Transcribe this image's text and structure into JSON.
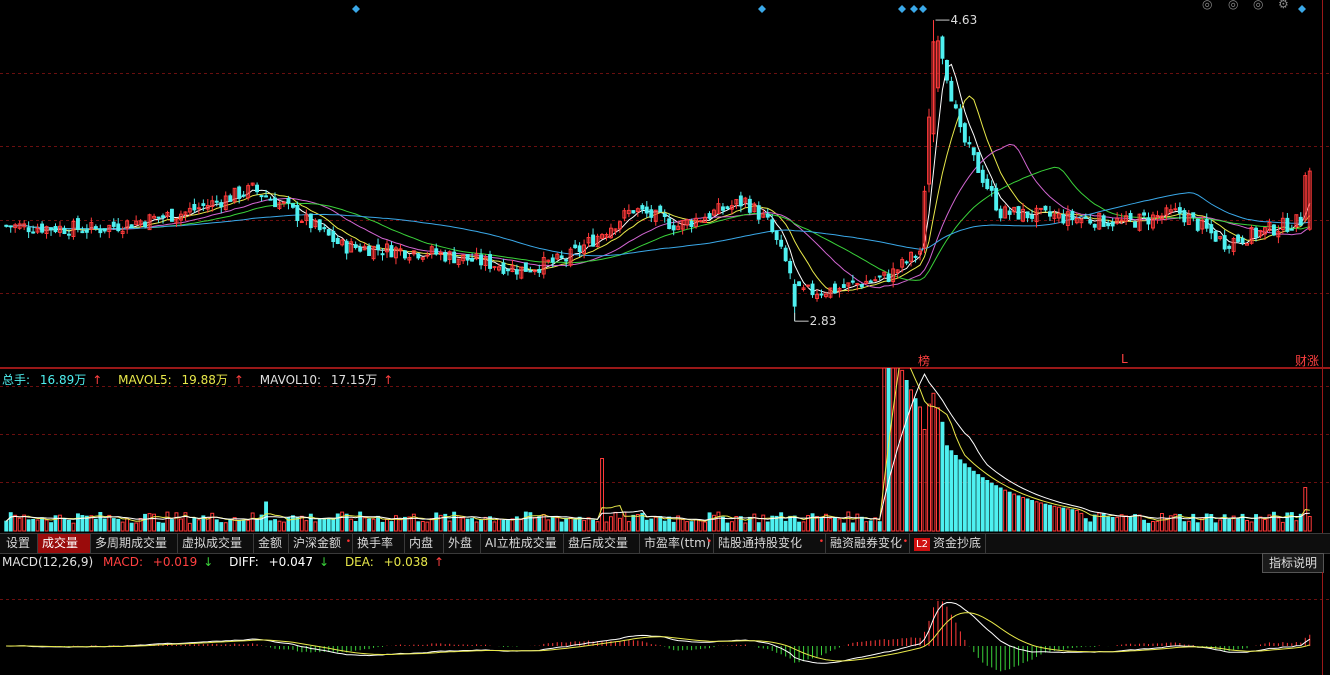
{
  "title": "",
  "price_panel": {
    "high_label": "4.63",
    "low_label": "2.83",
    "markers": [
      "榜",
      "L",
      "财"
    ],
    "marker_tail": "涨"
  },
  "volume_panel": {
    "label_total": "总手: ",
    "total": "16.89万",
    "label_mavol5": "MAVOL5: ",
    "mavol5": "19.88万",
    "label_mavol10": "MAVOL10: ",
    "mavol10": "17.15万",
    "arrow_up": "↑",
    "colors": {
      "total": "#4ff0f0",
      "mavol5": "#e8e84a",
      "mavol10": "#e0e0e0"
    }
  },
  "tabs": [
    {
      "label": "设置",
      "active": false
    },
    {
      "label": "成交量",
      "active": true
    },
    {
      "label": "多周期成交量",
      "active": false
    },
    {
      "label": "虚拟成交量",
      "active": false
    },
    {
      "label": "金额",
      "active": false
    },
    {
      "label": "沪深金额",
      "active": false
    },
    {
      "label": "换手率",
      "active": false
    },
    {
      "label": "内盘",
      "active": false
    },
    {
      "label": "外盘",
      "active": false
    },
    {
      "label": "AI立桩成交量",
      "active": false
    },
    {
      "label": "盘后成交量",
      "active": false
    },
    {
      "label": "市盈率(ttm)",
      "active": false
    },
    {
      "label": "陆股通持股变化",
      "active": false
    },
    {
      "label": "融资融券变化",
      "active": false
    },
    {
      "label": "资金抄底",
      "active": false
    }
  ],
  "l2_badge": "L2",
  "macd_panel": {
    "label": "MACD(12,26,9)",
    "macd_label": "MACD: ",
    "macd": "+0.019",
    "macd_arrow": "↓",
    "diff_label": "DIFF: ",
    "diff": "+0.047",
    "diff_arrow": "↓",
    "dea_label": "DEA: ",
    "dea": "+0.038",
    "dea_arrow": "↑",
    "help_button": "指标说明",
    "colors": {
      "label": "#e0e0e0",
      "macd": "#ff4040",
      "diff": "#ffffff",
      "dea": "#e8e84a"
    }
  },
  "colors": {
    "up": "#ff3a3a",
    "down": "#4ff0f0",
    "grid": "#6a0f0f",
    "border": "#9a1818",
    "ma5": "#ffffff",
    "ma10": "#e8e84a",
    "ma20": "#d266d2",
    "ma30": "#3ad23a",
    "ma60": "#3aa8e8",
    "marker_diamond": "#3aa8e8"
  },
  "chart_data": {
    "type": "candlestick",
    "title": "",
    "y_range": [
      2.55,
      4.75
    ],
    "price_max": 4.63,
    "price_min": 2.83,
    "segments": [
      {
        "from": 0,
        "to": 20,
        "start": 3.4,
        "end": 3.38
      },
      {
        "from": 20,
        "to": 40,
        "start": 3.38,
        "end": 3.48
      },
      {
        "from": 40,
        "to": 55,
        "start": 3.48,
        "end": 3.62
      },
      {
        "from": 55,
        "to": 62,
        "start": 3.62,
        "end": 3.52
      },
      {
        "from": 62,
        "to": 75,
        "start": 3.52,
        "end": 3.28
      },
      {
        "from": 75,
        "to": 95,
        "start": 3.28,
        "end": 3.24
      },
      {
        "from": 95,
        "to": 115,
        "start": 3.24,
        "end": 3.14
      },
      {
        "from": 115,
        "to": 125,
        "start": 3.14,
        "end": 3.2
      },
      {
        "from": 125,
        "to": 140,
        "start": 3.2,
        "end": 3.5
      },
      {
        "from": 140,
        "to": 150,
        "start": 3.5,
        "end": 3.4
      },
      {
        "from": 150,
        "to": 165,
        "start": 3.4,
        "end": 3.55
      },
      {
        "from": 165,
        "to": 170,
        "start": 3.55,
        "end": 3.42
      },
      {
        "from": 170,
        "to": 177,
        "start": 3.42,
        "end": 3.0
      },
      {
        "from": 177,
        "to": 185,
        "start": 3.0,
        "end": 3.02
      },
      {
        "from": 185,
        "to": 197,
        "start": 3.02,
        "end": 3.1
      },
      {
        "from": 197,
        "to": 204,
        "start": 3.1,
        "end": 3.25
      },
      {
        "from": 204,
        "to": 208,
        "start": 3.25,
        "end": 4.55
      },
      {
        "from": 208,
        "to": 213,
        "start": 4.55,
        "end": 3.95
      },
      {
        "from": 213,
        "to": 222,
        "start": 3.95,
        "end": 3.48
      },
      {
        "from": 222,
        "to": 250,
        "start": 3.48,
        "end": 3.42
      },
      {
        "from": 250,
        "to": 262,
        "start": 3.42,
        "end": 3.48
      },
      {
        "from": 262,
        "to": 272,
        "start": 3.48,
        "end": 3.3
      },
      {
        "from": 272,
        "to": 290,
        "start": 3.3,
        "end": 3.44
      },
      {
        "from": 290,
        "to": 292,
        "start": 3.44,
        "end": 3.72
      }
    ],
    "volume_spikes": [
      {
        "at": 58,
        "value": 8
      },
      {
        "at": 133,
        "value": 20
      },
      {
        "at": 205,
        "value": 28
      },
      {
        "at": 206,
        "value": 35
      },
      {
        "at": 207,
        "value": 38
      },
      {
        "at": 208,
        "value": 34
      },
      {
        "at": 209,
        "value": 30
      },
      {
        "at": 290,
        "value": 12
      }
    ],
    "volume_base": 3.5,
    "volume_max": 40
  }
}
